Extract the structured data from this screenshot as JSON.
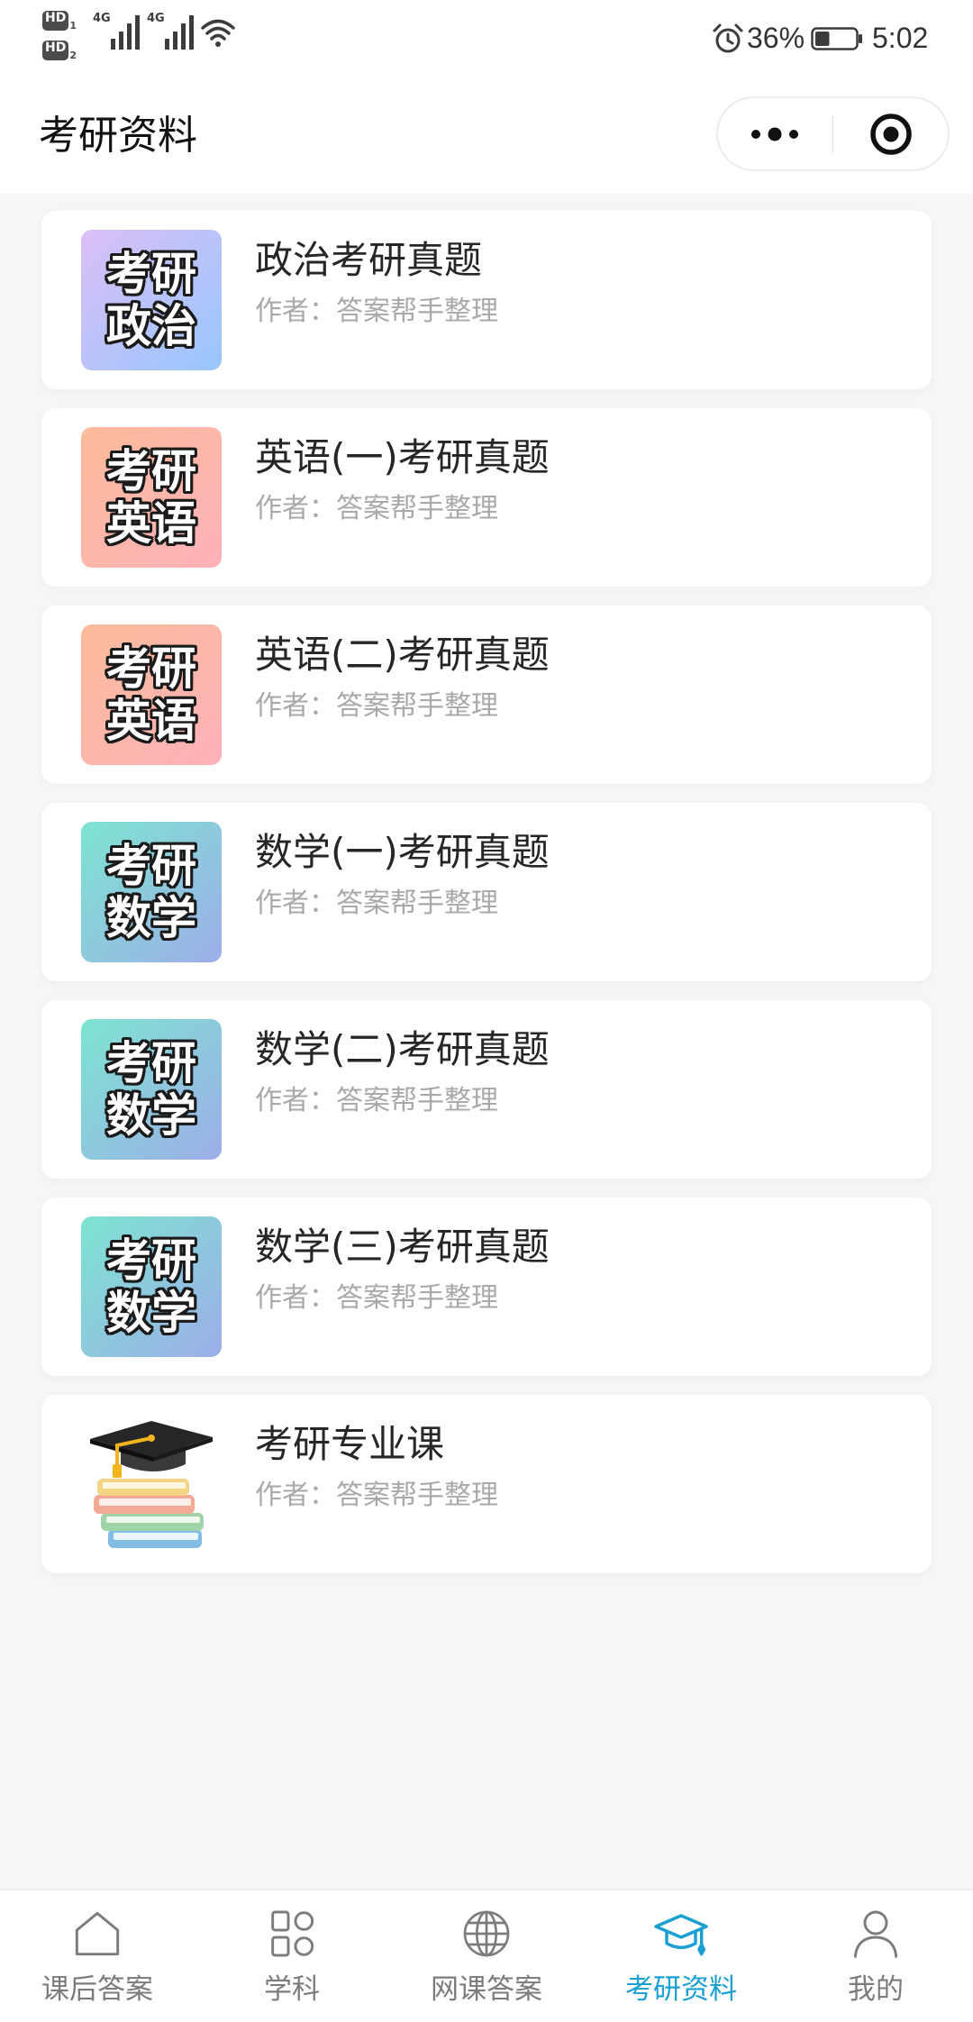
{
  "status_bar": {
    "sim_badges": [
      {
        "label": "HD",
        "num": "1"
      },
      {
        "label": "HD",
        "num": "2"
      }
    ],
    "networks": [
      "4G",
      "4G"
    ],
    "signal_icon": "signal-icon",
    "wifi_icon": "wifi-icon",
    "alarm_icon": "alarm-icon",
    "battery_icon": "battery-icon",
    "battery_text": "36%",
    "battery_level": 0.36,
    "time": "5:02"
  },
  "header": {
    "title": "考研资料",
    "more_icon": "more-dots-icon",
    "close_icon": "target-icon"
  },
  "list": [
    {
      "title": "政治考研真题",
      "author": "作者：答案帮手整理",
      "thumb": {
        "line1": "考研",
        "line2": "政治",
        "gradient": [
          "#dcbff7",
          "#97c7fd"
        ]
      }
    },
    {
      "title": "英语(一)考研真题",
      "author": "作者：答案帮手整理",
      "thumb": {
        "line1": "考研",
        "line2": "英语",
        "gradient": [
          "#fcbc9b",
          "#ffb1b9"
        ]
      }
    },
    {
      "title": "英语(二)考研真题",
      "author": "作者：答案帮手整理",
      "thumb": {
        "line1": "考研",
        "line2": "英语",
        "gradient": [
          "#fcbc9b",
          "#ffb1b9"
        ]
      }
    },
    {
      "title": "数学(一)考研真题",
      "author": "作者：答案帮手整理",
      "thumb": {
        "line1": "考研",
        "line2": "数学",
        "gradient": [
          "#7de4d1",
          "#9daee9"
        ]
      }
    },
    {
      "title": "数学(二)考研真题",
      "author": "作者：答案帮手整理",
      "thumb": {
        "line1": "考研",
        "line2": "数学",
        "gradient": [
          "#7de4d1",
          "#9daee9"
        ]
      }
    },
    {
      "title": "数学(三)考研真题",
      "author": "作者：答案帮手整理",
      "thumb": {
        "line1": "考研",
        "line2": "数学",
        "gradient": [
          "#7de4d1",
          "#9daee9"
        ]
      }
    },
    {
      "title": "考研专业课",
      "author": "作者：答案帮手整理",
      "thumb": {
        "icon": "graduation-cap-books-icon"
      }
    }
  ],
  "tabbar": {
    "active_index": 3,
    "items": [
      {
        "label": "课后答案",
        "icon": "home-icon"
      },
      {
        "label": "学科",
        "icon": "grid-icon"
      },
      {
        "label": "网课答案",
        "icon": "globe-icon"
      },
      {
        "label": "考研资料",
        "icon": "graduation-cap-icon"
      },
      {
        "label": "我的",
        "icon": "person-icon"
      }
    ]
  },
  "colors": {
    "background": "#f6f6f6",
    "surface": "#ffffff",
    "title_text": "#262626",
    "author_text": "#a9a9a9",
    "tab_inactive": "#7c7c7c",
    "tab_active": "#1a9fd3"
  }
}
